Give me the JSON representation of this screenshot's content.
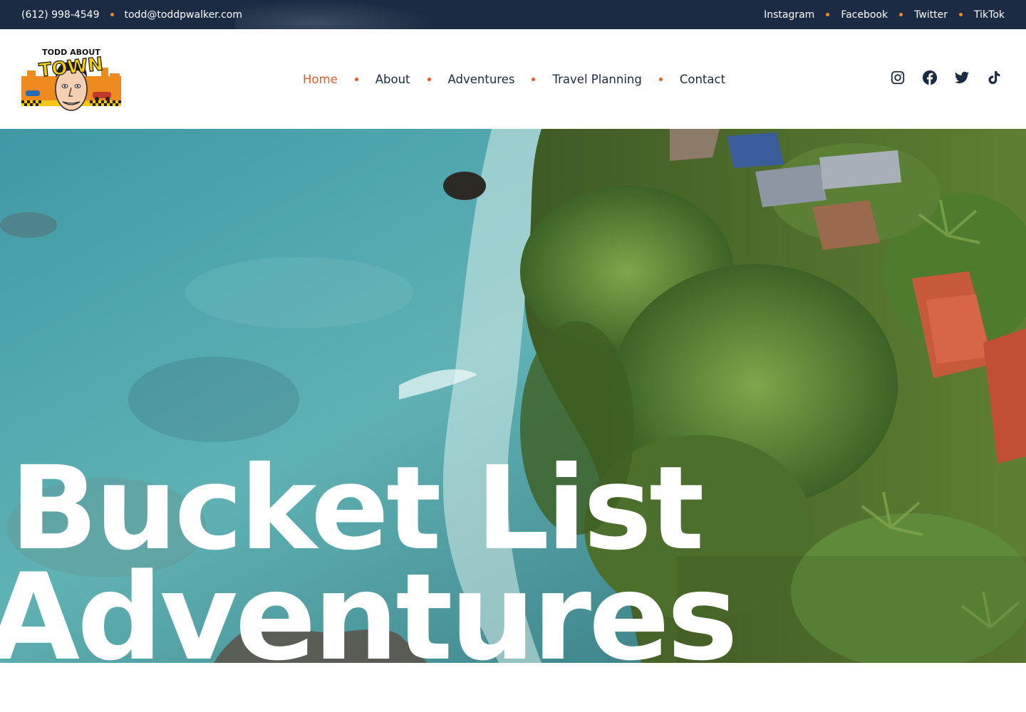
{
  "topbar": {
    "phone": "(612) 998-4549",
    "email": "todd@toddpwalker.com",
    "links": [
      "Instagram",
      "Facebook",
      "Twitter",
      "TikTok"
    ],
    "accent_color": "#ee8b25",
    "background": "#1b2b43"
  },
  "header": {
    "logo": {
      "top_text": "TODD ABOUT",
      "main_text": "TOWN"
    },
    "nav": {
      "items": [
        "Home",
        "About",
        "Adventures",
        "Travel Planning",
        "Contact"
      ],
      "active": "Home",
      "active_color": "#e65a2a"
    },
    "social_icons": [
      "instagram-icon",
      "facebook-icon",
      "twitter-icon",
      "tiktok-icon"
    ]
  },
  "hero": {
    "title_line1": "Bucket List",
    "title_line2": "Adventures",
    "title_color": "#ffffff"
  }
}
